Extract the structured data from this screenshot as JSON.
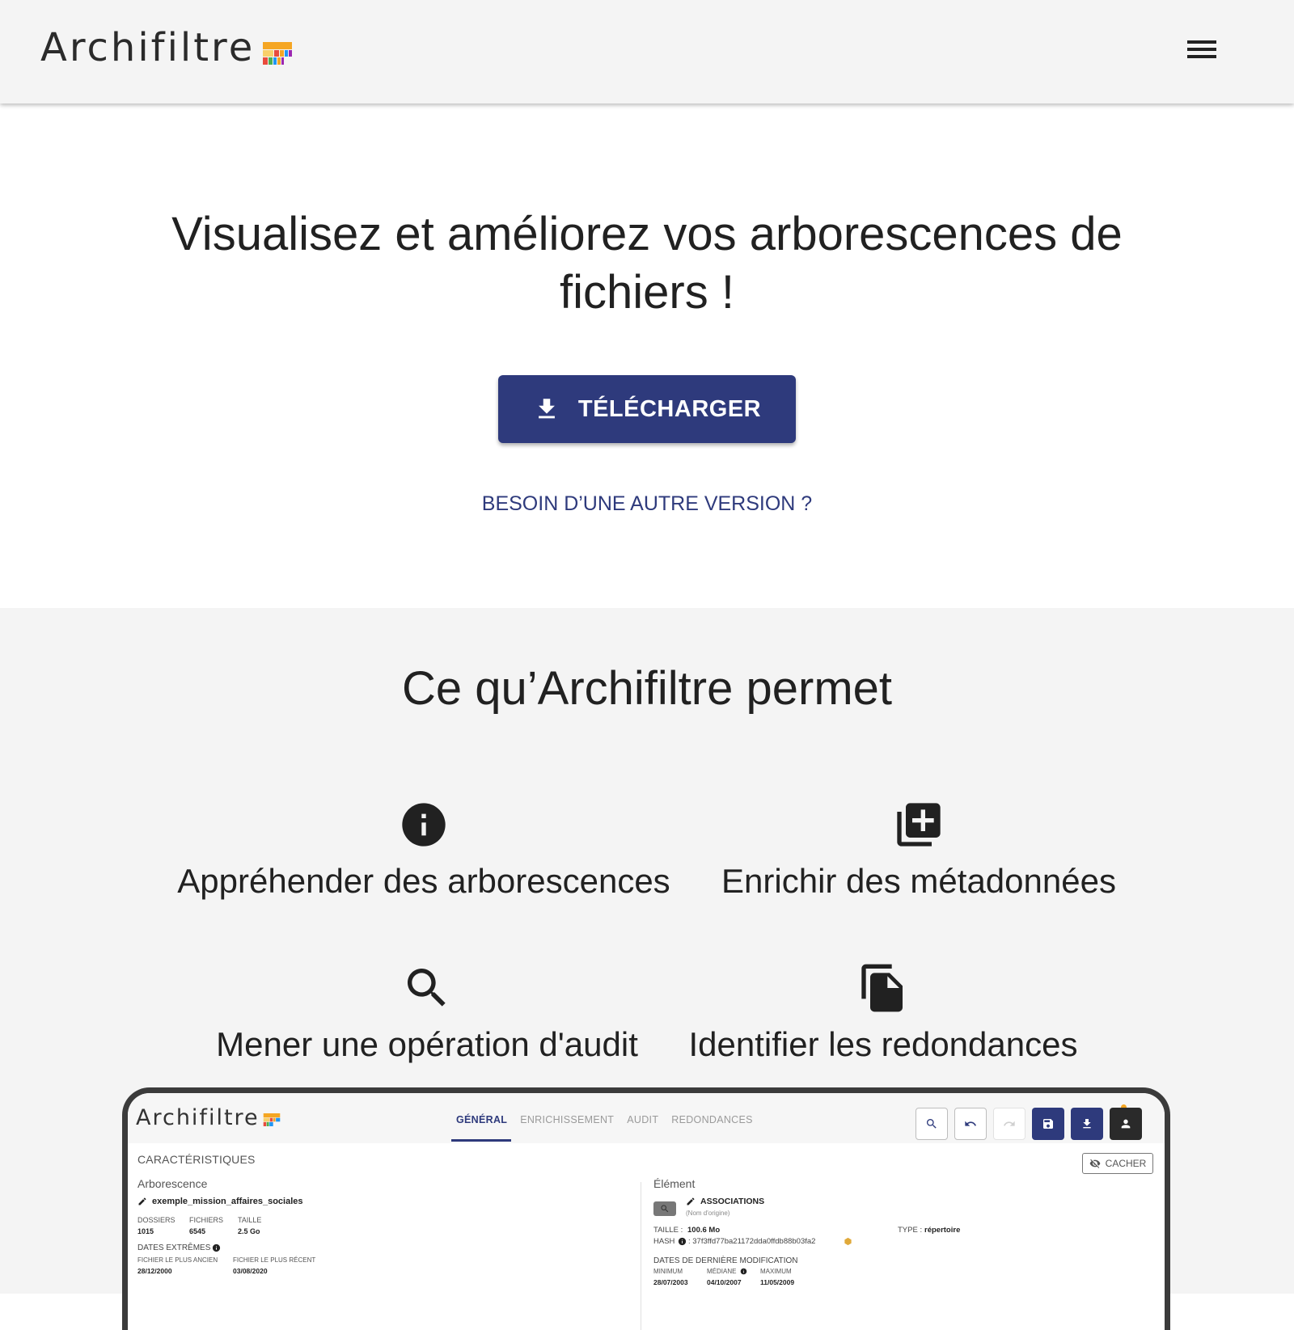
{
  "header": {
    "brand": "Archifiltre",
    "menu_icon": "hamburger-menu-icon",
    "logo_colors": [
      "#f5a623",
      "#f8d06b",
      "#e94b3c",
      "#4caf50",
      "#2196f3",
      "#9c27b0"
    ]
  },
  "hero": {
    "title": "Visualisez et améliorez vos arborescences de fichiers !",
    "download_label": "TÉLÉCHARGER",
    "other_version_link": "BESOIN D’UNE AUTRE VERSION ?"
  },
  "features": {
    "title": "Ce qu’Archifiltre permet",
    "items": [
      {
        "icon": "info-icon",
        "label": "Appréhender des arborescences"
      },
      {
        "icon": "add-library-icon",
        "label": "Enrichir des métadonnées"
      },
      {
        "icon": "search-icon",
        "label": "Mener une opération d'audit"
      },
      {
        "icon": "file-copy-icon",
        "label": "Identifier les redondances"
      }
    ]
  },
  "colors": {
    "primary": "#2e3a7c",
    "header_bg": "#f4f4f4",
    "section_bg": "#f4f4f4"
  },
  "screenshot_app": {
    "brand": "Archifiltre",
    "tabs": [
      "GÉNÉRAL",
      "ENRICHISSEMENT",
      "AUDIT",
      "REDONDANCES"
    ],
    "active_tab": "GÉNÉRAL",
    "hide_button": "CACHER",
    "section_title": "CARACTÉRISTIQUES",
    "left": {
      "heading": "Arborescence",
      "name": "exemple_mission_affaires_sociales",
      "stats_labels": [
        "DOSSIERS",
        "FICHIERS",
        "TAILLE"
      ],
      "stats_values": [
        "1015",
        "6545",
        "2.5 Go"
      ],
      "dates_title": "DATES EXTRÊMES",
      "oldest_label": "FICHIER LE PLUS ANCIEN",
      "newest_label": "FICHIER LE PLUS RÉCENT",
      "oldest_value": "28/12/2000",
      "newest_value": "03/08/2020"
    },
    "right": {
      "heading": "Élément",
      "name": "ASSOCIATIONS",
      "origin": "(Nom d'origine)",
      "size_label": "TAILLE :",
      "size_value": "100.6 Mo",
      "hash_label": "HASH",
      "hash_value": ": 37f3ffd77ba21172dda0ffdb88b03fa2",
      "type_label": "TYPE :",
      "type_value": "répertoire",
      "mod_title": "DATES DE DERNIÈRE MODIFICATION",
      "min_label": "MINIMUM",
      "median_label": "MÉDIANE",
      "max_label": "MAXIMUM",
      "min_value": "28/07/2003",
      "median_value": "04/10/2007",
      "max_value": "11/05/2009"
    }
  }
}
